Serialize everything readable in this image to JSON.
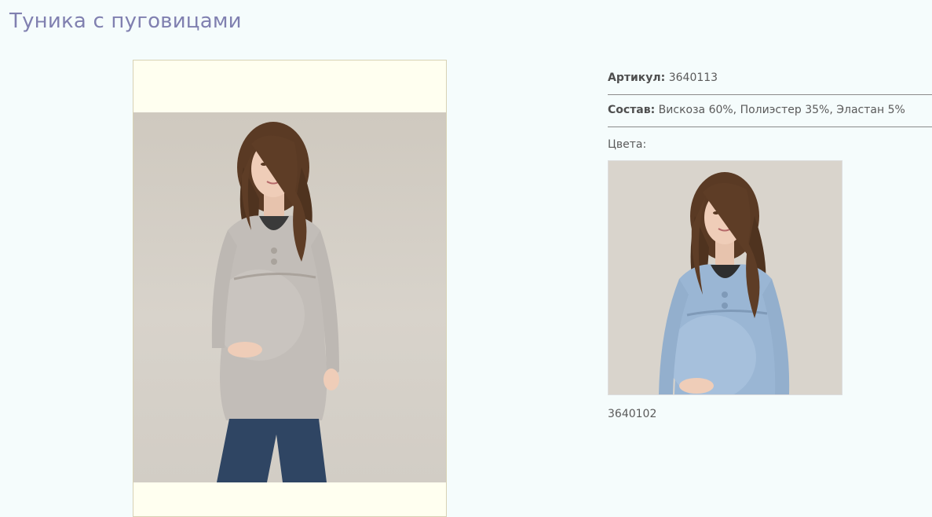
{
  "product": {
    "title": "Туника с пуговицами",
    "article_label": "Артикул:",
    "article_value": "3640113",
    "composition_label": "Состав:",
    "composition_value": "Вискоза 60%, Полиэстер 35%, Эластан 5%",
    "colors_label": "Цвета:"
  },
  "variants": [
    {
      "code": "3640102",
      "color": "#9ab6d4"
    }
  ],
  "main_image": {
    "garment_color": "#c2bdb8",
    "jeans_color": "#2f4563"
  }
}
